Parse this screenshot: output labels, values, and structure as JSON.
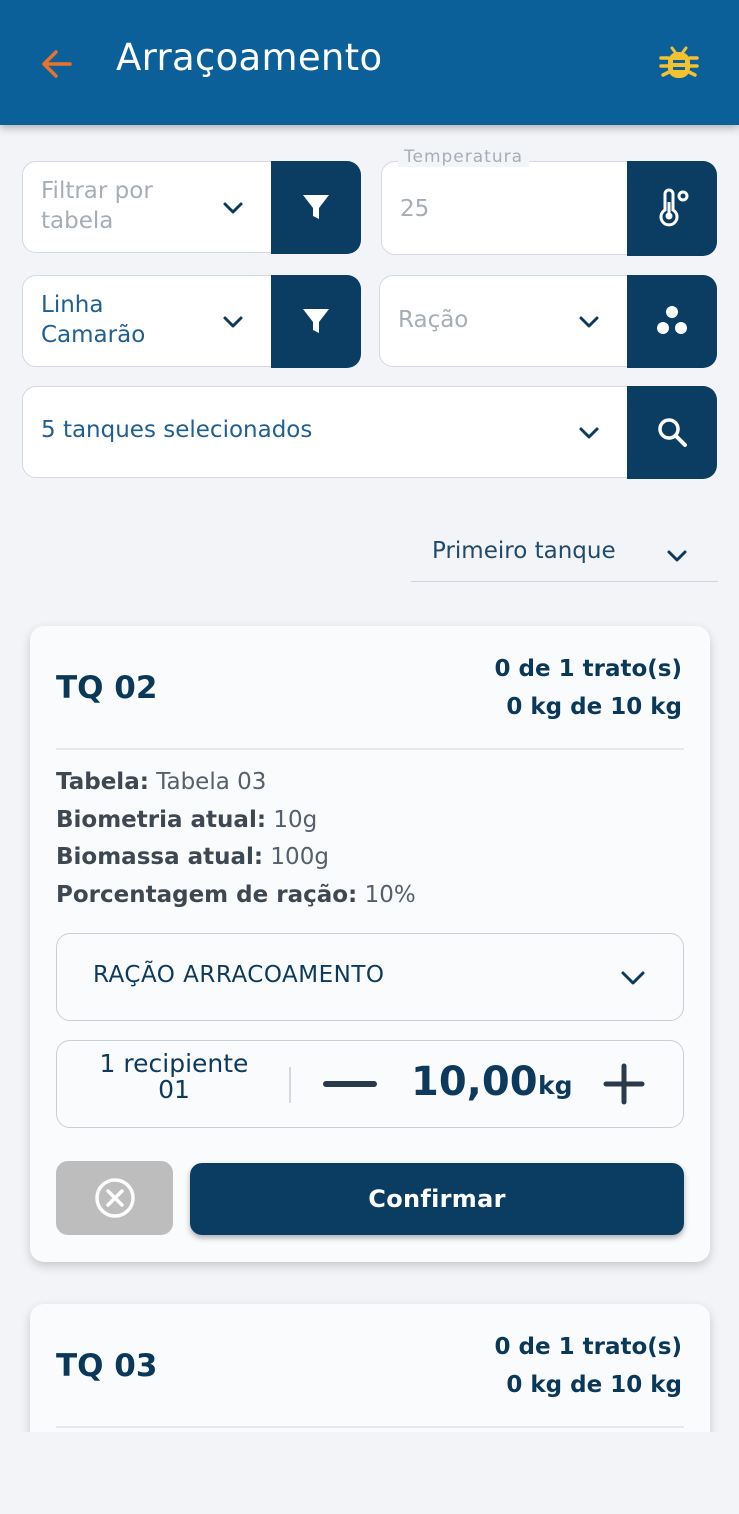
{
  "appbar": {
    "title": "Arraçoamento",
    "back_icon": "arrow-left-icon",
    "debug_icon": "bug-icon",
    "colors": {
      "bar": "#0b609a",
      "back_arrow": "#e8742c",
      "bug": "#f2c230"
    }
  },
  "filters": {
    "table_filter": {
      "placeholder": "Filtrar por\ntabela",
      "button_icon": "filter-icon"
    },
    "temperature": {
      "label": "Temperatura",
      "value": "25",
      "button_icon": "thermometer-icon"
    },
    "line_filter": {
      "value": "Linha\nCamarão",
      "button_icon": "filter-icon"
    },
    "feed": {
      "placeholder": "Ração",
      "button_icon": "feed-pellets-icon"
    },
    "tanks": {
      "value": "5 tanques selecionados",
      "button_icon": "search-icon"
    }
  },
  "sort": {
    "value": "Primeiro tanque"
  },
  "cards": [
    {
      "tank": "TQ 02",
      "treatments": "0 de 1 trato(s)",
      "weight": "0 kg de 10 kg",
      "info": {
        "table_label": "Tabela:",
        "table_value": "Tabela 03",
        "biometry_label": "Biometria atual:",
        "biometry_value": "10g",
        "biomass_label": "Biomassa atual:",
        "biomass_value": "100g",
        "feed_pct_label": "Porcentagem de ração:",
        "feed_pct_value": "10%"
      },
      "feed_select": "RAÇÃO ARRACOAMENTO",
      "stepper": {
        "container_line1": "1 recipiente",
        "container_line2": "01",
        "quantity": "10,00",
        "unit": "kg"
      },
      "confirm_label": "Confirmar"
    },
    {
      "tank": "TQ 03",
      "treatments": "0 de 1 trato(s)",
      "weight": "0 kg de 10 kg"
    }
  ],
  "colors": {
    "primary_dark": "#0a3d61",
    "background": "#f3f4f8",
    "cancel_gray": "#bdbdbd"
  }
}
